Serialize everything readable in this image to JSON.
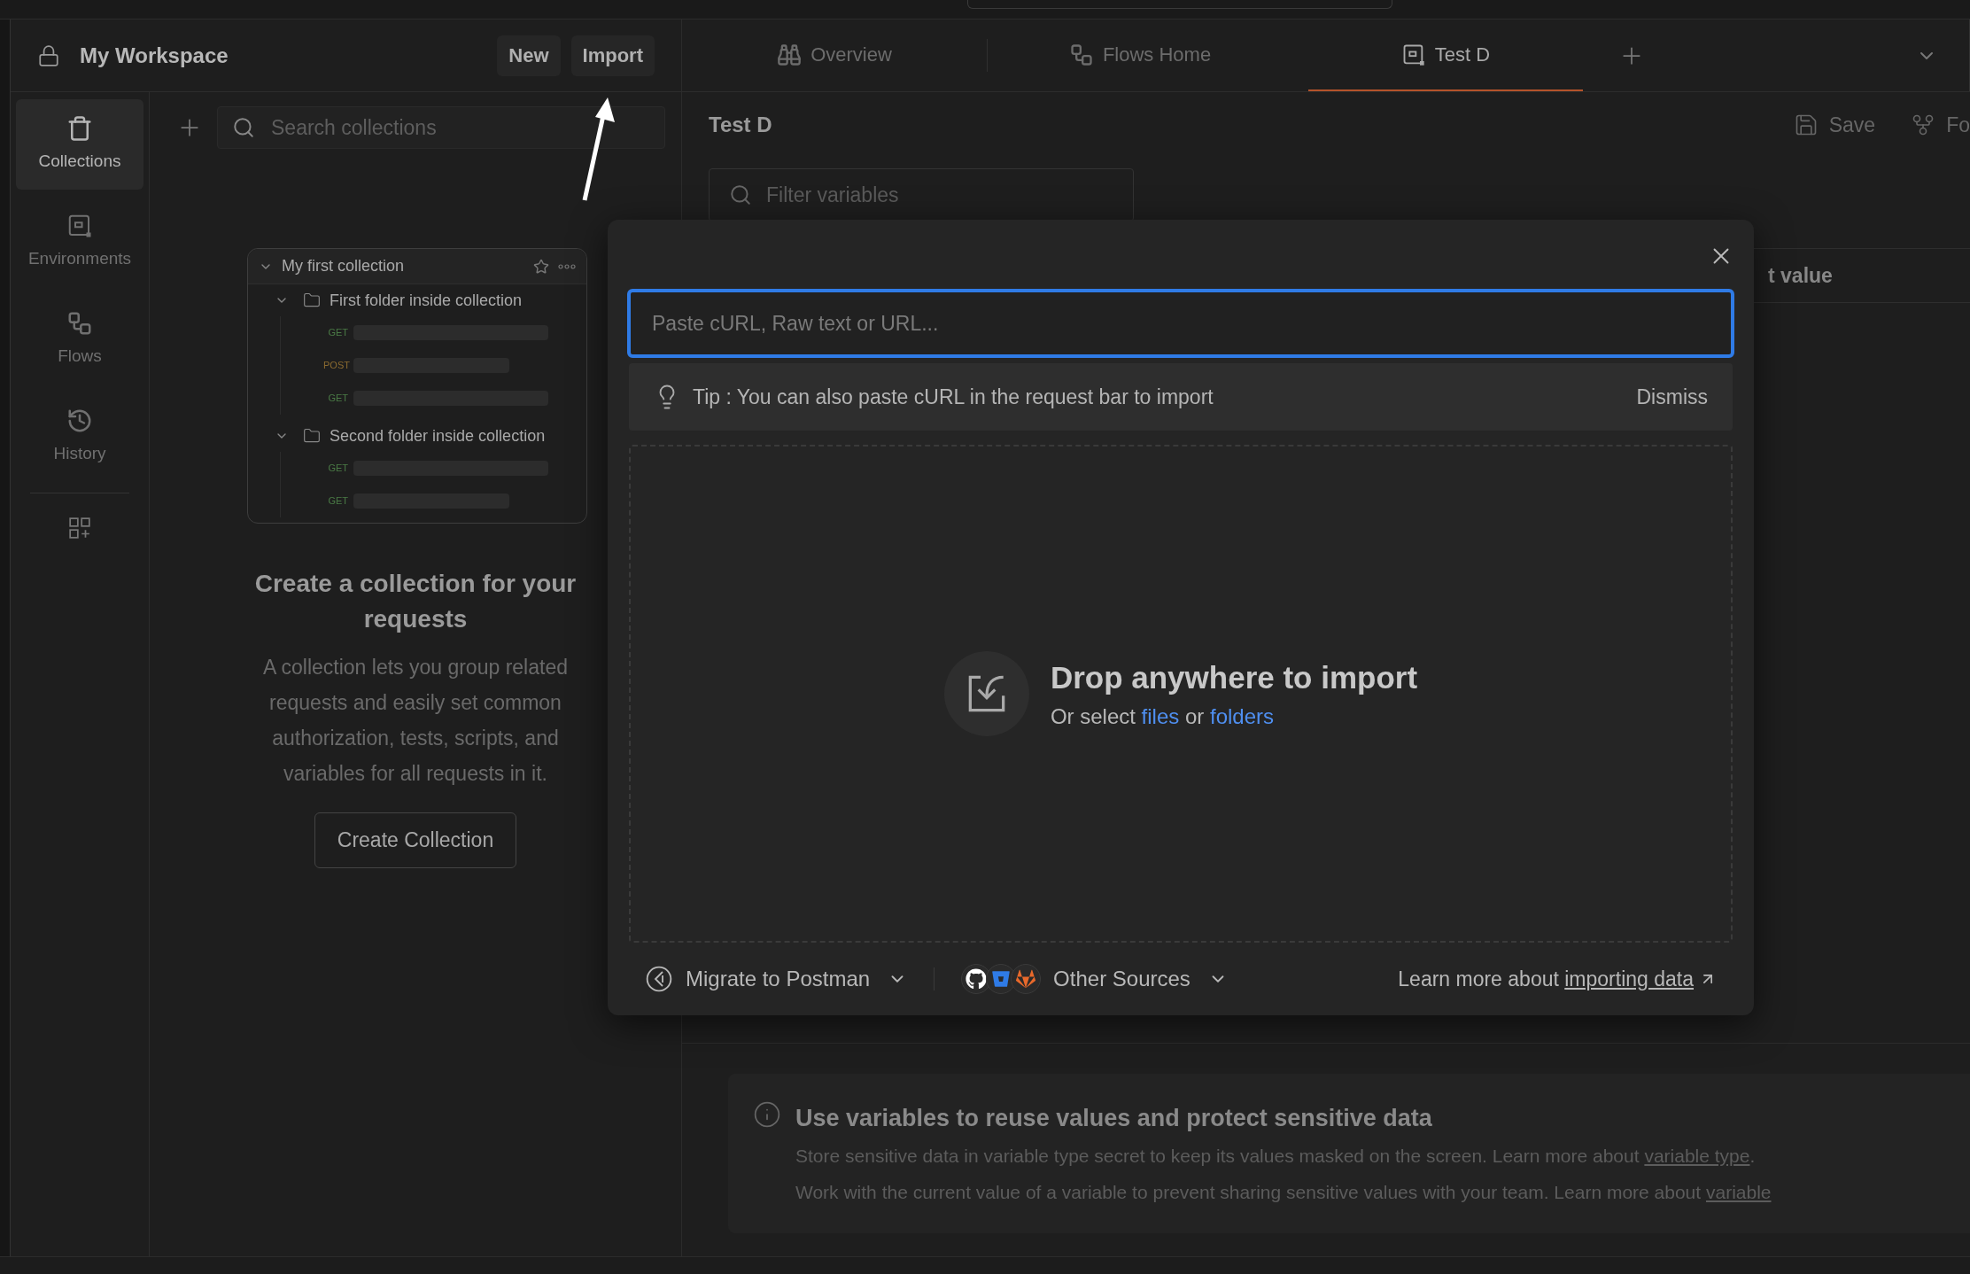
{
  "workspace": {
    "title": "My Workspace",
    "buttons": [
      "New",
      "Import"
    ]
  },
  "tabs": [
    {
      "label": "Overview",
      "selected": false
    },
    {
      "label": "Flows Home",
      "selected": false
    },
    {
      "label": "Test D",
      "selected": true
    }
  ],
  "sidebar": {
    "items": [
      {
        "label": "Collections",
        "selected": true
      },
      {
        "label": "Environments",
        "selected": false
      },
      {
        "label": "Flows",
        "selected": false
      },
      {
        "label": "History",
        "selected": false
      }
    ]
  },
  "collections_pane": {
    "search_placeholder": "Search collections",
    "preview": {
      "collection": "My first collection",
      "folders": [
        {
          "name": "First folder inside collection",
          "requests": [
            {
              "method": "GET",
              "color": "#4a7a45"
            },
            {
              "method": "POST",
              "color": "#8a6a30"
            },
            {
              "method": "GET",
              "color": "#4a7a45"
            }
          ]
        },
        {
          "name": "Second folder inside collection",
          "requests": [
            {
              "method": "GET",
              "color": "#4a7a45"
            },
            {
              "method": "GET",
              "color": "#4a7a45"
            }
          ]
        }
      ]
    },
    "empty_title": "Create a collection for your requests",
    "empty_text": "A collection lets you group related requests and easily set common authorization, tests, scripts, and variables for all requests in it.",
    "button": "Create Collection"
  },
  "environment": {
    "title": "Test D",
    "actions": [
      "Save",
      "Fo"
    ],
    "filter_placeholder": "Filter variables",
    "column_fragment": "t value",
    "info": {
      "title": "Use variables to reuse values and protect sensitive data",
      "lines": [
        [
          {
            "kind": "text",
            "text": "Store sensitive data in variable type secret to keep its values masked on the screen. Learn more about "
          },
          {
            "kind": "link",
            "text": "variable type"
          },
          {
            "kind": "text",
            "text": "."
          }
        ],
        [
          {
            "kind": "text",
            "text": "Work with the current value of a variable to prevent sharing sensitive values with your team. Learn more about "
          },
          {
            "kind": "link",
            "text": "variable"
          }
        ]
      ]
    }
  },
  "import_dialog": {
    "input_placeholder": "Paste cURL, Raw text or URL...",
    "tip": "Tip : You can also paste cURL in the request bar to import",
    "dismiss": "Dismiss",
    "drop_title": "Drop anywhere to import",
    "drop_sub": [
      {
        "kind": "text",
        "text": "Or select "
      },
      {
        "kind": "link",
        "text": "files"
      },
      {
        "kind": "text",
        "text": " or "
      },
      {
        "kind": "link",
        "text": "folders"
      }
    ],
    "migrate": "Migrate to Postman",
    "other_sources": "Other Sources",
    "learn_more": [
      {
        "kind": "text",
        "text": "Learn more about "
      },
      {
        "kind": "link",
        "text": "importing data"
      }
    ]
  }
}
